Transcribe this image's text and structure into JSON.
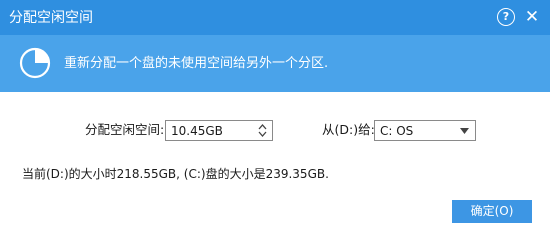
{
  "window": {
    "title": "分配空闲空间",
    "help_glyph": "?",
    "close_glyph": "✕"
  },
  "banner": {
    "icon": "pie-chart-icon",
    "text": "重新分配一个盘的未使用空间给另外一个分区."
  },
  "form": {
    "size_label": "分配空闲空间:",
    "size_value": "10.45GB",
    "source_label": "从(D:)给:",
    "target_value": "C: OS"
  },
  "info": "当前(D:)的大小时218.55GB, (C:)盘的大小是239.35GB.",
  "buttons": {
    "ok_label": "确定(O)"
  },
  "colors": {
    "titlebar": "#2f8fe0",
    "banner": "#4aa3ea",
    "button": "#3d96e4"
  }
}
